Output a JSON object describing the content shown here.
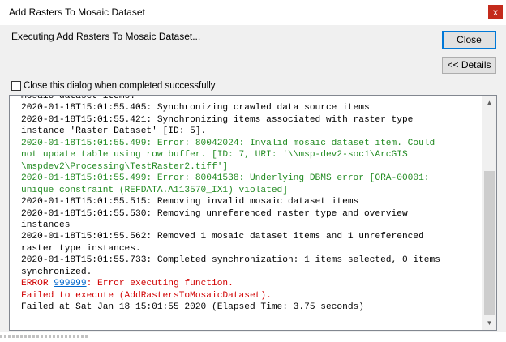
{
  "window": {
    "title": "Add Rasters To Mosaic Dataset",
    "close_glyph": "x"
  },
  "status_text": "Executing Add Rasters To Mosaic Dataset...",
  "buttons": {
    "close": "Close",
    "details": "<< Details"
  },
  "checkbox": {
    "label": "Close this dialog when completed successfully",
    "checked": false
  },
  "log": {
    "l0": "mosaic dataset items.",
    "l1": "2020-01-18T15:01:55.405: Synchronizing crawled data source items",
    "l2": "2020-01-18T15:01:55.421: Synchronizing items associated with raster type",
    "l3": "instance 'Raster Dataset' [ID: 5].",
    "l4": "2020-01-18T15:01:55.499: Error: 80042024: Invalid mosaic dataset item. Could",
    "l5": "not update table using row buffer. [ID: 7, URI: '\\\\msp-dev2-soc1\\ArcGIS",
    "l6": "\\mspdev2\\Processing\\TestRaster2.tiff']",
    "l7": "2020-01-18T15:01:55.499: Error: 80041538: Underlying DBMS error [ORA-00001:",
    "l8": "unique constraint (REFDATA.A113570_IX1) violated]",
    "l9": "2020-01-18T15:01:55.515: Removing invalid mosaic dataset items",
    "l10": "2020-01-18T15:01:55.530: Removing unreferenced raster type and overview",
    "l11": "instances",
    "l12": "2020-01-18T15:01:55.562: Removed 1 mosaic dataset items and 1 unreferenced",
    "l13": "raster type instances.",
    "l14": "2020-01-18T15:01:55.733: Completed synchronization: 1 items selected, 0 items",
    "l15": "synchronized.",
    "error_prefix": "ERROR ",
    "error_code": "999999",
    "error_suffix": ": Error executing function.",
    "failed_execute": "Failed to execute (AddRastersToMosaicDataset).",
    "failed_at": "Failed at Sat Jan 18 15:01:55 2020 (Elapsed Time: 3.75 seconds)"
  },
  "scrollbar": {
    "up_glyph": "▲",
    "down_glyph": "▼",
    "position_fraction": 1.0
  },
  "colors": {
    "error_red": "#d00000",
    "warning_green": "#238b23",
    "link_blue": "#0066cc",
    "close_button_red": "#c42b1c"
  }
}
